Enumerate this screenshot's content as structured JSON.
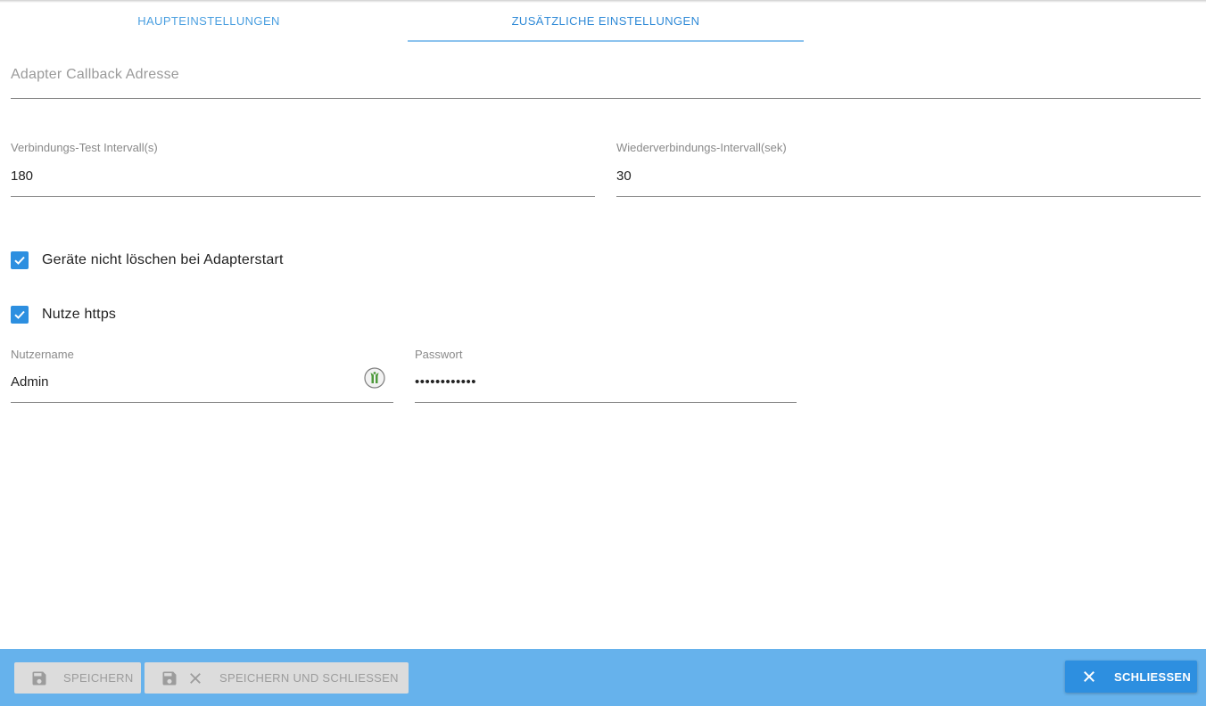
{
  "tabs": [
    {
      "label": "HAUPTEINSTELLUNGEN",
      "active": false
    },
    {
      "label": "ZUSÄTZLICHE EINSTELLUNGEN",
      "active": true
    }
  ],
  "callback": {
    "placeholder": "Adapter Callback Adresse",
    "value": ""
  },
  "connection_test": {
    "label": "Verbindungs-Test Intervall(s)",
    "value": "180"
  },
  "reconnect": {
    "label": "Wiederverbindungs-Intervall(sek)",
    "value": "30"
  },
  "checkboxes": [
    {
      "label": "Geräte nicht löschen bei Adapterstart",
      "checked": true
    },
    {
      "label": "Nutze https",
      "checked": true
    }
  ],
  "username": {
    "label": "Nutzername",
    "value": "Admin"
  },
  "password": {
    "label": "Passwort",
    "value": "••••••••••••"
  },
  "footer": {
    "save_label": "SPEICHERN",
    "save_close_label": "SPEICHERN UND SCHLIESSEN",
    "close_label": "SCHLIESSEN"
  },
  "colors": {
    "accent": "#2d8fe0",
    "footer_bg": "#66b2ec",
    "tab_text": "#4a9fe0",
    "disabled_bg": "#dcdcdc"
  },
  "icons": {
    "save": "floppy-disk-icon",
    "close": "close-x-icon",
    "check": "check-icon",
    "password_manager": "keeper-icon"
  }
}
